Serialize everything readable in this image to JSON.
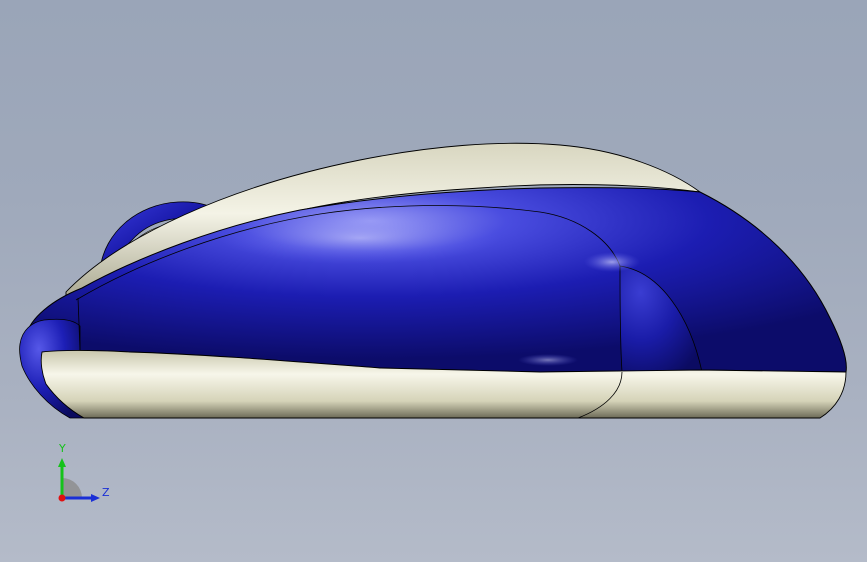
{
  "viewport": {
    "background_top": "#9aa5b8",
    "background_bottom": "#b4bbc9"
  },
  "model": {
    "name": "mouse",
    "view": "side",
    "colors": {
      "shell_blue": "#1a1aa8",
      "shell_blue_highlight": "#8f90f2",
      "base_cream": "#e4e2c6",
      "base_cream_shadow": "#9c9a84",
      "edge": "#000000"
    }
  },
  "triad": {
    "y_label": "Y",
    "z_label": "Z",
    "y_color": "#15c21a",
    "z_color": "#1a2fd6",
    "x_color": "#e01010"
  }
}
